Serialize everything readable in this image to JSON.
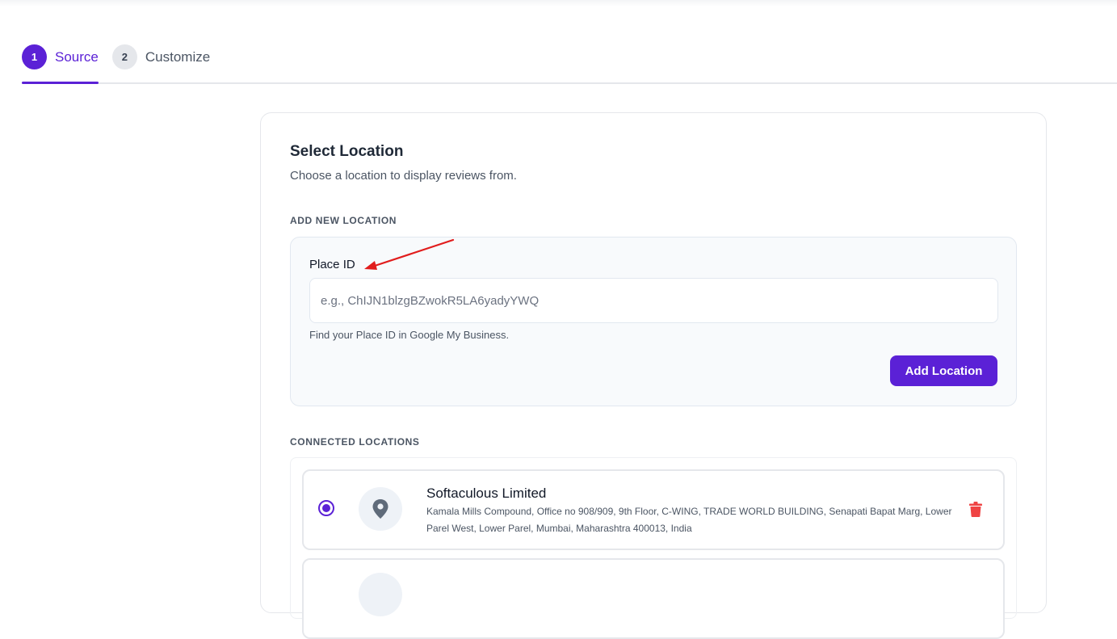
{
  "stepper": {
    "steps": [
      {
        "number": "1",
        "label": "Source",
        "active": true
      },
      {
        "number": "2",
        "label": "Customize",
        "active": false
      }
    ]
  },
  "card": {
    "title": "Select Location",
    "subtitle": "Choose a location to display reviews from.",
    "add_section_label": "ADD NEW LOCATION",
    "place_id_label": "Place ID",
    "place_id_placeholder": "e.g., ChIJN1blzgBZwokR5LA6yadyYWQ",
    "place_id_value": "",
    "hint": "Find your Place ID in Google My Business.",
    "add_button": "Add Location",
    "connected_section_label": "CONNECTED LOCATIONS"
  },
  "locations": [
    {
      "name": "Softaculous Limited",
      "address": "Kamala Mills Compound, Office no 908/909, 9th Floor, C-WING, TRADE WORLD BUILDING, Senapati Bapat Marg, Lower Parel West, Lower Parel, Mumbai, Maharashtra 400013, India",
      "selected": true,
      "icon": "map-pin-icon"
    }
  ],
  "colors": {
    "accent": "#5b21d6",
    "delete": "#ef4444",
    "annotation_arrow": "#e11d1d"
  }
}
